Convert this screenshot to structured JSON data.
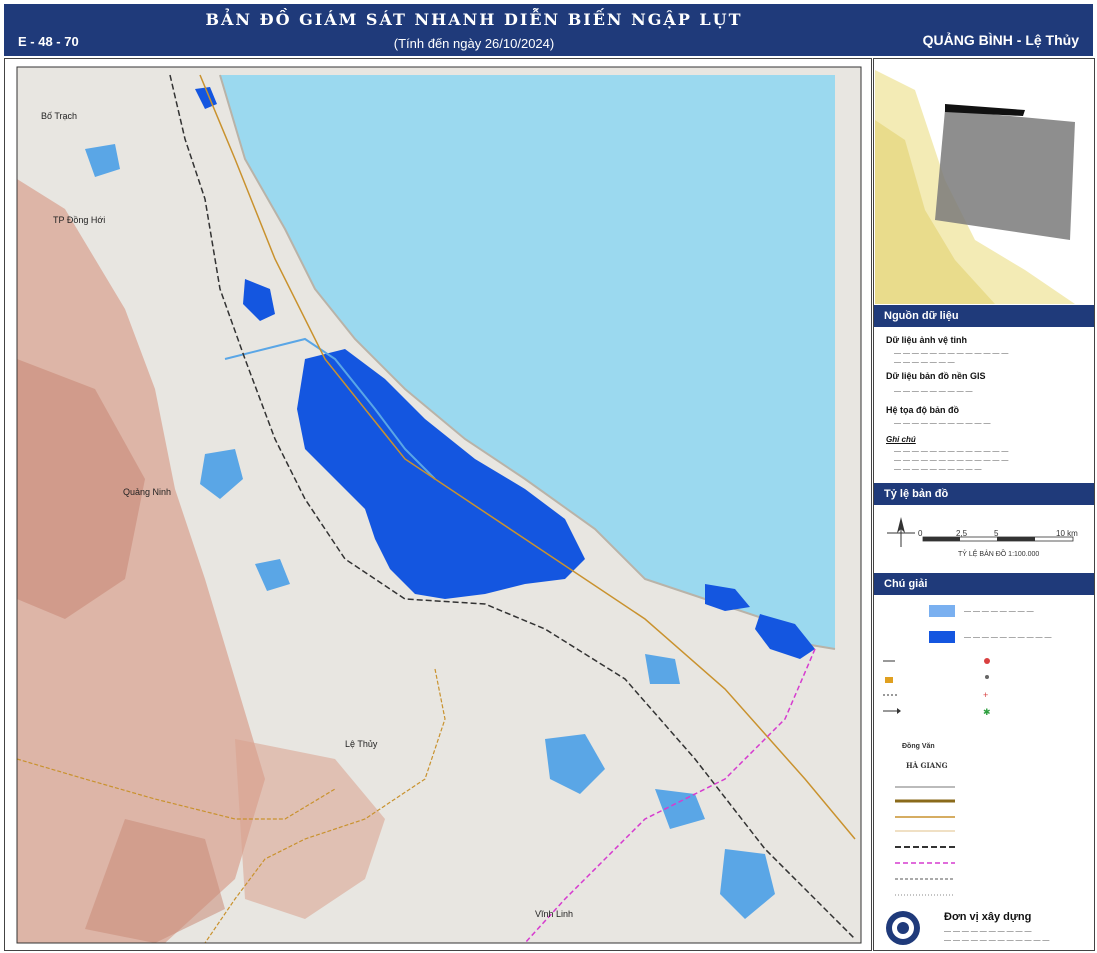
{
  "header": {
    "map_code": "E - 48 - 70",
    "title": "BẢN ĐỒ GIÁM SÁT NHANH DIỄN BIẾN NGẬP LỤT",
    "date": "(Tính đến ngày 26/10/2024)",
    "region": "QUẢNG BÌNH - Lệ Thủy"
  },
  "map": {
    "places": [
      "Bố Trạch",
      "TP Đồng Hới",
      "Quảng Ninh",
      "Lệ Thủy",
      "Vĩnh Linh"
    ],
    "colors": {
      "sea": "#9bd9ef",
      "land": "#e8e6e1",
      "relief": "#d9a08e",
      "flood": "#1456e0",
      "water": "#5aa6e6",
      "header": "#1f3a7a"
    }
  },
  "panel": {
    "sources_title": "Nguồn dữ liệu",
    "sat_title": "Dữ liệu ảnh vệ tinh",
    "gis_title": "Dữ liệu bản đồ nền GIS",
    "crs_title": "Hệ tọa độ bản đồ",
    "note_title": "Ghi chú",
    "scale_title": "Tỷ lệ bản đồ",
    "scale_text": "TỶ LỆ BẢN ĐỒ 1:100.000",
    "scale_ticks": [
      "0",
      "2,5",
      "5",
      "10 km"
    ],
    "legend_title": "Chú giải",
    "org_title": "Đơn vị xây dựng",
    "legend_samples": [
      "Đồng Văn",
      "HÀ GIANG"
    ]
  }
}
